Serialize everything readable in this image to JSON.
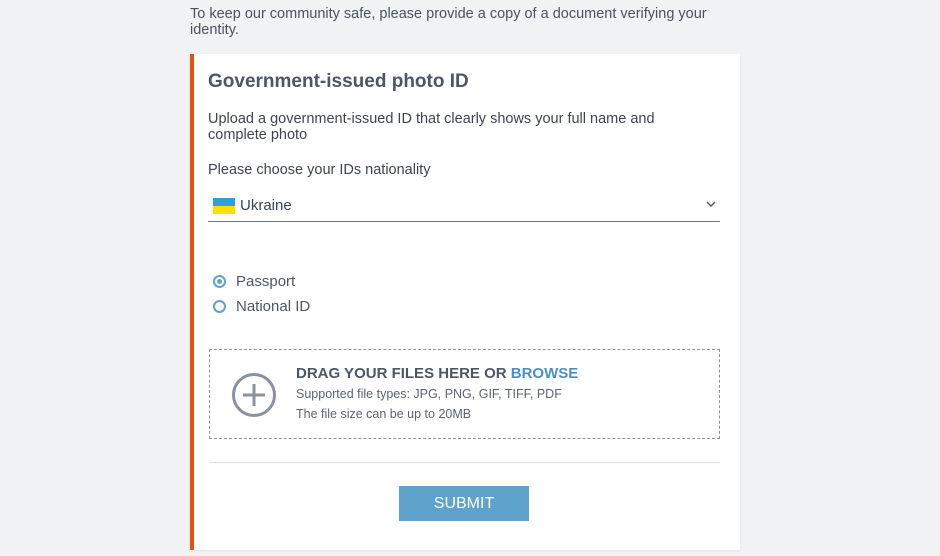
{
  "intro_text": "To keep our community safe, please provide a copy of a document verifying your identity.",
  "card": {
    "title": "Government-issued photo ID",
    "description": "Upload a government-issued ID that clearly shows your full name and complete photo",
    "nationality_label": "Please choose your IDs nationality",
    "nationality_select": {
      "value": "Ukraine",
      "flag_icon": "ukraine-flag-icon",
      "dropdown_icon": "chevron-down-icon"
    },
    "id_types": [
      {
        "label": "Passport",
        "checked": true
      },
      {
        "label": "National ID",
        "checked": false
      }
    ],
    "dropzone": {
      "icon": "plus-circle-icon",
      "heading_prefix": "DRAG YOUR FILES HERE OR ",
      "browse_label": "BROWSE",
      "supported_types": "Supported file types: JPG, PNG, GIF, TIFF, PDF",
      "size_limit": "The file size can be up to 20MB"
    },
    "submit_label": "SUBMIT"
  },
  "colors": {
    "accent_border": "#e8500f",
    "primary": "#5fa2cc",
    "link": "#4a90c8",
    "background": "#f1f2f4"
  }
}
